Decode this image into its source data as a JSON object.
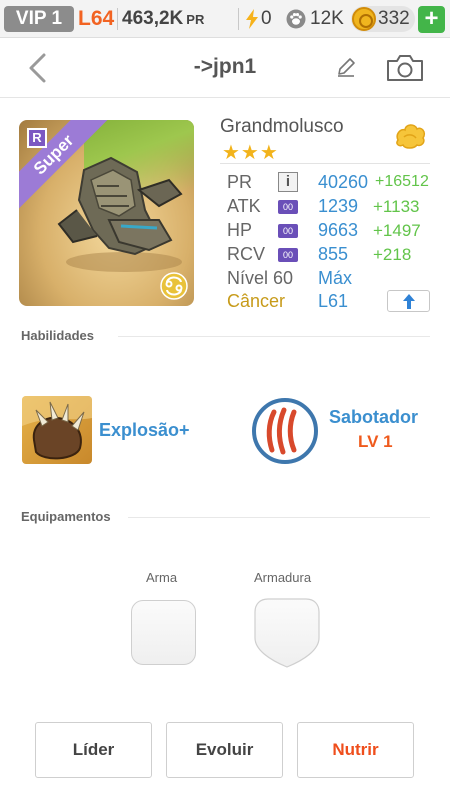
{
  "status_bar": {
    "vip": "VIP 1",
    "level": "L64",
    "power": "463,2K",
    "power_unit": "PR",
    "energy": "0",
    "paw": "12K",
    "coins": "332",
    "add": "+"
  },
  "header": {
    "title": "->jpn1"
  },
  "monster": {
    "rarity_letter": "R",
    "tier": "Super",
    "name": "Grandmolusco",
    "stars": "★★★",
    "stats": [
      {
        "label": "PR",
        "value": "40260",
        "bonus": "+16512"
      },
      {
        "label": "ATK",
        "value": "1239",
        "bonus": "+1133"
      },
      {
        "label": "HP",
        "value": "9663",
        "bonus": "+1497"
      },
      {
        "label": "RCV",
        "value": "855",
        "bonus": "+218"
      }
    ],
    "level_label": "Nível 60",
    "level_value": "Máx",
    "sign": "Câncer",
    "sign_level": "L61",
    "info_symbol": "i",
    "badge_text": "00"
  },
  "abilities": {
    "section_label": "Habilidades",
    "skill1_name": "Explosão+",
    "skill2_name": "Sabotador",
    "skill2_level": "LV 1"
  },
  "equipment": {
    "section_label": "Equipamentos",
    "weapon_label": "Arma",
    "armor_label": "Armadura"
  },
  "actions": {
    "leader": "Líder",
    "evolve": "Evoluir",
    "feed": "Nutrir"
  },
  "colors": {
    "accent_blue": "#3a8fd0",
    "bonus_green": "#62c44a",
    "level_orange": "#f26322",
    "gold": "#c79b1a"
  }
}
